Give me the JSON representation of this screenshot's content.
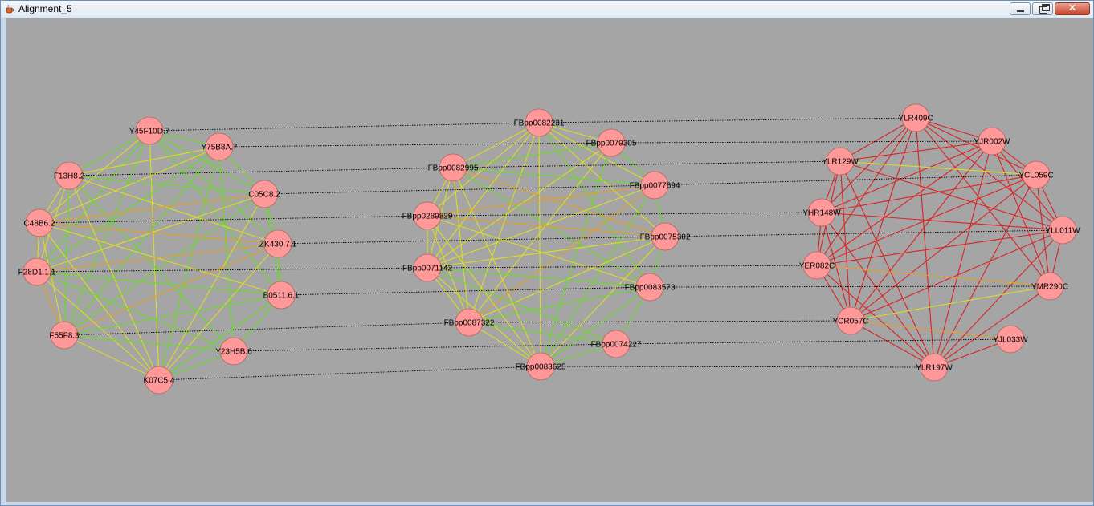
{
  "window": {
    "title": "Alignment_5",
    "icon": "java-cup-icon",
    "controls": [
      "minimize-icon",
      "restore-icon",
      "close-icon"
    ]
  },
  "colors": {
    "canvas_bg": "#a5a5a5",
    "node_fill": "#ff9999",
    "node_stroke": "#b06060",
    "alignment_line": "#000000",
    "edge_green": "#66dd22",
    "edge_yellow": "#dddd22",
    "edge_orange": "#e8a020",
    "edge_red": "#dd2222"
  },
  "graph": {
    "networks": [
      {
        "nodes": [
          {
            "id": "Y45F10D.7",
            "label": "Y45F10D.7"
          },
          {
            "id": "Y75B8A.7",
            "label": "Y75B8A.7"
          },
          {
            "id": "F13H8.2",
            "label": "F13H8.2"
          },
          {
            "id": "C05C8.2",
            "label": "C05C8.2"
          },
          {
            "id": "C48B6.2",
            "label": "C48B6.2"
          },
          {
            "id": "ZK430.7.1",
            "label": "ZK430.7.1"
          },
          {
            "id": "F28D1.1.1",
            "label": "F28D1.1.1"
          },
          {
            "id": "B0511.6.1",
            "label": "B0511.6.1"
          },
          {
            "id": "F55F8.3",
            "label": "F55F8.3"
          },
          {
            "id": "Y23H5B.6",
            "label": "Y23H5B.6"
          },
          {
            "id": "K07C5.4",
            "label": "K07C5.4"
          }
        ]
      },
      {
        "nodes": [
          {
            "id": "FBpp0082231",
            "label": "FBpp0082231"
          },
          {
            "id": "FBpp0079305",
            "label": "FBpp0079305"
          },
          {
            "id": "FBpp0082995",
            "label": "FBpp0082995"
          },
          {
            "id": "FBpp0077694",
            "label": "FBpp0077694"
          },
          {
            "id": "FBpp0289829",
            "label": "FBpp0289829"
          },
          {
            "id": "FBpp0075302",
            "label": "FBpp0075302"
          },
          {
            "id": "FBpp0071142",
            "label": "FBpp0071142"
          },
          {
            "id": "FBpp0083573",
            "label": "FBpp0083573"
          },
          {
            "id": "FBpp0087322",
            "label": "FBpp0087322"
          },
          {
            "id": "FBpp0074227",
            "label": "FBpp0074227"
          },
          {
            "id": "FBpp0083625",
            "label": "FBpp0083625"
          }
        ]
      },
      {
        "nodes": [
          {
            "id": "YLR409C",
            "label": "YLR409C"
          },
          {
            "id": "YJR002W",
            "label": "YJR002W"
          },
          {
            "id": "YLR129W",
            "label": "YLR129W"
          },
          {
            "id": "YCL059C",
            "label": "YCL059C"
          },
          {
            "id": "YHR148W",
            "label": "YHR148W"
          },
          {
            "id": "YLL011W",
            "label": "YLL011W"
          },
          {
            "id": "YER082C",
            "label": "YER082C"
          },
          {
            "id": "YMR290C",
            "label": "YMR290C"
          },
          {
            "id": "YCR057C",
            "label": "YCR057C"
          },
          {
            "id": "YJL033W",
            "label": "YJL033W"
          },
          {
            "id": "YLR197W",
            "label": "YLR197W"
          }
        ]
      }
    ],
    "edges": [
      [
        "Y45F10D.7",
        "Y75B8A.7",
        "green"
      ],
      [
        "Y45F10D.7",
        "F13H8.2",
        "green"
      ],
      [
        "Y45F10D.7",
        "C05C8.2",
        "green"
      ],
      [
        "Y45F10D.7",
        "C48B6.2",
        "yellow"
      ],
      [
        "Y45F10D.7",
        "ZK430.7.1",
        "green"
      ],
      [
        "Y45F10D.7",
        "F28D1.1.1",
        "green"
      ],
      [
        "Y45F10D.7",
        "F55F8.3",
        "green"
      ],
      [
        "Y45F10D.7",
        "K07C5.4",
        "yellow"
      ],
      [
        "Y45F10D.7",
        "B0511.6.1",
        "green"
      ],
      [
        "Y75B8A.7",
        "F13H8.2",
        "yellow"
      ],
      [
        "Y75B8A.7",
        "C05C8.2",
        "green"
      ],
      [
        "Y75B8A.7",
        "C48B6.2",
        "yellow"
      ],
      [
        "Y75B8A.7",
        "F28D1.1.1",
        "green"
      ],
      [
        "Y75B8A.7",
        "K07C5.4",
        "green"
      ],
      [
        "Y75B8A.7",
        "F55F8.3",
        "green"
      ],
      [
        "Y75B8A.7",
        "Y23H5B.6",
        "green"
      ],
      [
        "F13H8.2",
        "C48B6.2",
        "yellow"
      ],
      [
        "F13H8.2",
        "F28D1.1.1",
        "yellow"
      ],
      [
        "F13H8.2",
        "F55F8.3",
        "green"
      ],
      [
        "F13H8.2",
        "K07C5.4",
        "yellow"
      ],
      [
        "F13H8.2",
        "C05C8.2",
        "green"
      ],
      [
        "F13H8.2",
        "ZK430.7.1",
        "yellow"
      ],
      [
        "F13H8.2",
        "Y23H5B.6",
        "green"
      ],
      [
        "C05C8.2",
        "C48B6.2",
        "orange"
      ],
      [
        "C05C8.2",
        "ZK430.7.1",
        "green"
      ],
      [
        "C05C8.2",
        "F28D1.1.1",
        "yellow"
      ],
      [
        "C05C8.2",
        "K07C5.4",
        "yellow"
      ],
      [
        "C05C8.2",
        "F55F8.3",
        "green"
      ],
      [
        "C05C8.2",
        "B0511.6.1",
        "green"
      ],
      [
        "C48B6.2",
        "F28D1.1.1",
        "yellow"
      ],
      [
        "C48B6.2",
        "ZK430.7.1",
        "orange"
      ],
      [
        "C48B6.2",
        "K07C5.4",
        "yellow"
      ],
      [
        "C48B6.2",
        "F55F8.3",
        "yellow"
      ],
      [
        "C48B6.2",
        "B0511.6.1",
        "yellow"
      ],
      [
        "ZK430.7.1",
        "F28D1.1.1",
        "orange"
      ],
      [
        "ZK430.7.1",
        "K07C5.4",
        "yellow"
      ],
      [
        "ZK430.7.1",
        "F55F8.3",
        "orange"
      ],
      [
        "ZK430.7.1",
        "B0511.6.1",
        "green"
      ],
      [
        "F28D1.1.1",
        "F55F8.3",
        "orange"
      ],
      [
        "F28D1.1.1",
        "K07C5.4",
        "yellow"
      ],
      [
        "F28D1.1.1",
        "B0511.6.1",
        "green"
      ],
      [
        "F28D1.1.1",
        "Y23H5B.6",
        "green"
      ],
      [
        "F55F8.3",
        "K07C5.4",
        "yellow"
      ],
      [
        "F55F8.3",
        "B0511.6.1",
        "green"
      ],
      [
        "F55F8.3",
        "Y23H5B.6",
        "green"
      ],
      [
        "K07C5.4",
        "B0511.6.1",
        "green"
      ],
      [
        "K07C5.4",
        "Y23H5B.6",
        "green"
      ],
      [
        "B0511.6.1",
        "Y23H5B.6",
        "green"
      ],
      [
        "FBpp0082231",
        "FBpp0079305",
        "yellow"
      ],
      [
        "FBpp0082231",
        "FBpp0082995",
        "yellow"
      ],
      [
        "FBpp0082231",
        "FBpp0077694",
        "yellow"
      ],
      [
        "FBpp0082231",
        "FBpp0289829",
        "yellow"
      ],
      [
        "FBpp0082231",
        "FBpp0075302",
        "yellow"
      ],
      [
        "FBpp0082231",
        "FBpp0071142",
        "yellow"
      ],
      [
        "FBpp0082231",
        "FBpp0087322",
        "yellow"
      ],
      [
        "FBpp0082231",
        "FBpp0083625",
        "yellow"
      ],
      [
        "FBpp0082231",
        "FBpp0083573",
        "green"
      ],
      [
        "FBpp0079305",
        "FBpp0082995",
        "green"
      ],
      [
        "FBpp0079305",
        "FBpp0077694",
        "green"
      ],
      [
        "FBpp0079305",
        "FBpp0071142",
        "yellow"
      ],
      [
        "FBpp0079305",
        "FBpp0087322",
        "yellow"
      ],
      [
        "FBpp0079305",
        "FBpp0083625",
        "green"
      ],
      [
        "FBpp0082995",
        "FBpp0289829",
        "yellow"
      ],
      [
        "FBpp0082995",
        "FBpp0077694",
        "green"
      ],
      [
        "FBpp0082995",
        "FBpp0075302",
        "orange"
      ],
      [
        "FBpp0082995",
        "FBpp0071142",
        "yellow"
      ],
      [
        "FBpp0082995",
        "FBpp0087322",
        "yellow"
      ],
      [
        "FBpp0082995",
        "FBpp0083625",
        "yellow"
      ],
      [
        "FBpp0082995",
        "FBpp0083573",
        "green"
      ],
      [
        "FBpp0077694",
        "FBpp0289829",
        "orange"
      ],
      [
        "FBpp0077694",
        "FBpp0075302",
        "green"
      ],
      [
        "FBpp0077694",
        "FBpp0071142",
        "yellow"
      ],
      [
        "FBpp0077694",
        "FBpp0087322",
        "orange"
      ],
      [
        "FBpp0077694",
        "FBpp0083625",
        "green"
      ],
      [
        "FBpp0289829",
        "FBpp0075302",
        "orange"
      ],
      [
        "FBpp0289829",
        "FBpp0071142",
        "yellow"
      ],
      [
        "FBpp0289829",
        "FBpp0087322",
        "yellow"
      ],
      [
        "FBpp0289829",
        "FBpp0083573",
        "yellow"
      ],
      [
        "FBpp0289829",
        "FBpp0083625",
        "yellow"
      ],
      [
        "FBpp0075302",
        "FBpp0071142",
        "yellow"
      ],
      [
        "FBpp0075302",
        "FBpp0087322",
        "yellow"
      ],
      [
        "FBpp0075302",
        "FBpp0083625",
        "yellow"
      ],
      [
        "FBpp0075302",
        "FBpp0083573",
        "green"
      ],
      [
        "FBpp0071142",
        "FBpp0087322",
        "yellow"
      ],
      [
        "FBpp0071142",
        "FBpp0083625",
        "yellow"
      ],
      [
        "FBpp0071142",
        "FBpp0074227",
        "green"
      ],
      [
        "FBpp0071142",
        "FBpp0083573",
        "green"
      ],
      [
        "FBpp0083573",
        "FBpp0087322",
        "green"
      ],
      [
        "FBpp0083573",
        "FBpp0083625",
        "green"
      ],
      [
        "FBpp0083573",
        "FBpp0074227",
        "green"
      ],
      [
        "FBpp0087322",
        "FBpp0083625",
        "yellow"
      ],
      [
        "FBpp0087322",
        "FBpp0074227",
        "green"
      ],
      [
        "FBpp0074227",
        "FBpp0083625",
        "green"
      ],
      [
        "YLR409C",
        "YJR002W",
        "red"
      ],
      [
        "YLR409C",
        "YLR129W",
        "red"
      ],
      [
        "YLR409C",
        "YCL059C",
        "red"
      ],
      [
        "YLR409C",
        "YHR148W",
        "red"
      ],
      [
        "YLR409C",
        "YLL011W",
        "red"
      ],
      [
        "YLR409C",
        "YER082C",
        "red"
      ],
      [
        "YLR409C",
        "YCR057C",
        "red"
      ],
      [
        "YLR409C",
        "YLR197W",
        "red"
      ],
      [
        "YLR409C",
        "YMR290C",
        "red"
      ],
      [
        "YJR002W",
        "YLR129W",
        "red"
      ],
      [
        "YJR002W",
        "YCL059C",
        "red"
      ],
      [
        "YJR002W",
        "YHR148W",
        "red"
      ],
      [
        "YJR002W",
        "YLL011W",
        "red"
      ],
      [
        "YJR002W",
        "YER082C",
        "red"
      ],
      [
        "YJR002W",
        "YCR057C",
        "red"
      ],
      [
        "YJR002W",
        "YLR197W",
        "red"
      ],
      [
        "YJR002W",
        "YMR290C",
        "red"
      ],
      [
        "YLR129W",
        "YCL059C",
        "yellow"
      ],
      [
        "YLR129W",
        "YHR148W",
        "red"
      ],
      [
        "YLR129W",
        "YER082C",
        "red"
      ],
      [
        "YLR129W",
        "YCR057C",
        "red"
      ],
      [
        "YLR129W",
        "YLR197W",
        "red"
      ],
      [
        "YLR129W",
        "YLL011W",
        "red"
      ],
      [
        "YCL059C",
        "YHR148W",
        "red"
      ],
      [
        "YCL059C",
        "YLL011W",
        "red"
      ],
      [
        "YCL059C",
        "YER082C",
        "red"
      ],
      [
        "YCL059C",
        "YCR057C",
        "red"
      ],
      [
        "YCL059C",
        "YLR197W",
        "red"
      ],
      [
        "YCL059C",
        "YMR290C",
        "red"
      ],
      [
        "YHR148W",
        "YLL011W",
        "red"
      ],
      [
        "YHR148W",
        "YER082C",
        "red"
      ],
      [
        "YHR148W",
        "YCR057C",
        "red"
      ],
      [
        "YHR148W",
        "YLR197W",
        "red"
      ],
      [
        "YLL011W",
        "YER082C",
        "red"
      ],
      [
        "YLL011W",
        "YCR057C",
        "red"
      ],
      [
        "YLL011W",
        "YLR197W",
        "red"
      ],
      [
        "YLL011W",
        "YMR290C",
        "red"
      ],
      [
        "YER082C",
        "YCR057C",
        "red"
      ],
      [
        "YER082C",
        "YLR197W",
        "red"
      ],
      [
        "YER082C",
        "YMR290C",
        "orange"
      ],
      [
        "YCR057C",
        "YLR197W",
        "red"
      ],
      [
        "YCR057C",
        "YMR290C",
        "yellow"
      ],
      [
        "YCR057C",
        "YJL033W",
        "orange"
      ],
      [
        "YMR290C",
        "YLR197W",
        "red"
      ],
      [
        "YJL033W",
        "YLR197W",
        "red"
      ]
    ],
    "alignments": [
      [
        "Y45F10D.7",
        "FBpp0082231",
        "YLR409C"
      ],
      [
        "Y75B8A.7",
        "FBpp0079305",
        "YJR002W"
      ],
      [
        "F13H8.2",
        "FBpp0082995",
        "YLR129W"
      ],
      [
        "C05C8.2",
        "FBpp0077694",
        "YCL059C"
      ],
      [
        "C48B6.2",
        "FBpp0289829",
        "YHR148W"
      ],
      [
        "ZK430.7.1",
        "FBpp0075302",
        "YLL011W"
      ],
      [
        "F28D1.1.1",
        "FBpp0071142",
        "YER082C"
      ],
      [
        "B0511.6.1",
        "FBpp0083573",
        "YMR290C"
      ],
      [
        "F55F8.3",
        "FBpp0087322",
        "YCR057C"
      ],
      [
        "Y23H5B.6",
        "FBpp0074227",
        "YJL033W"
      ],
      [
        "K07C5.4",
        "FBpp0083625",
        "YLR197W"
      ]
    ]
  }
}
